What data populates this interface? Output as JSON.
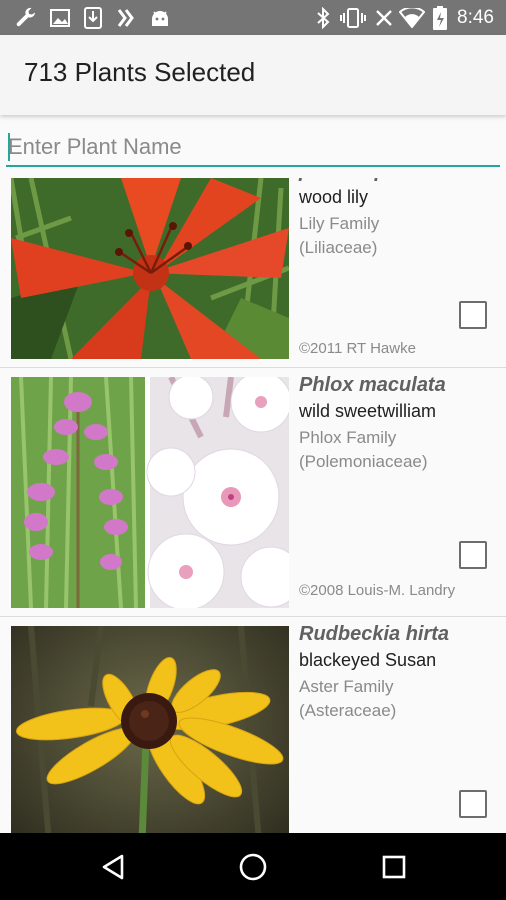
{
  "status_bar": {
    "time": "8:46",
    "left_icons": [
      "wrench-icon",
      "image-icon",
      "download-icon",
      "feedly-icon",
      "android-icon"
    ],
    "right_icons": [
      "bluetooth-icon",
      "vibrate-icon",
      "close-icon",
      "wifi-icon",
      "battery-charging-icon"
    ]
  },
  "app_bar": {
    "title": "713 Plants Selected"
  },
  "search": {
    "placeholder": "Enter Plant Name",
    "value": ""
  },
  "plants": [
    {
      "scientific_name": "philadelphicum",
      "common_name": "wood lily",
      "family": "Lily Family",
      "family_latin": "(Liliaceae)",
      "copyright": "©2011 RT Hawke",
      "checked": false
    },
    {
      "scientific_name": "Phlox maculata",
      "common_name": "wild sweetwilliam",
      "family": "Phlox Family",
      "family_latin": "(Polemoniaceae)",
      "copyright": "©2008 Louis-M. Landry",
      "checked": false
    },
    {
      "scientific_name": "Rudbeckia hirta",
      "common_name": "blackeyed Susan",
      "family": "Aster Family",
      "family_latin": "(Asteraceae)",
      "copyright": "",
      "checked": false
    }
  ],
  "nav_bar": [
    "back-icon",
    "home-icon",
    "recents-icon"
  ],
  "colors": {
    "accent": "#26a69a",
    "status_bar": "#757575",
    "app_bar": "#f5f5f5",
    "nav_bar": "#000000"
  }
}
